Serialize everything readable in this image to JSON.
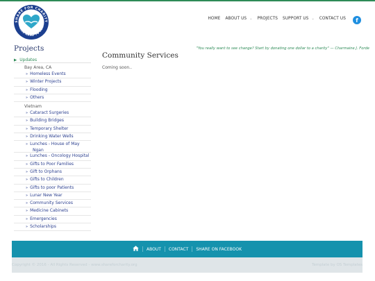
{
  "logo": {
    "top_text": "SHARE FOR CHARITY",
    "bottom_text": "SHARE HAND TO HELP"
  },
  "nav": {
    "items": [
      {
        "label": "HOME",
        "dropdown": false
      },
      {
        "label": "ABOUT US",
        "dropdown": true
      },
      {
        "label": "PROJECTS",
        "dropdown": false
      },
      {
        "label": "SUPPORT US",
        "dropdown": true
      },
      {
        "label": "CONTACT US",
        "dropdown": false
      }
    ],
    "facebook_glyph": "f"
  },
  "sidebar": {
    "title": "Projects",
    "updates_label": "Updates",
    "groups": [
      {
        "label": "Bay Area, CA",
        "items": [
          "Homeless Events",
          "Winter Projects",
          "Flooding",
          "Others"
        ]
      },
      {
        "label": "Vietnam",
        "items": [
          "Cataract Surgeries",
          "Building Bridges",
          "Temporary Shelter",
          "Drinking Water Wells",
          "Lunches - House of May Ngan",
          "Lunches - Oncology Hospital",
          "Gifts to Poor Families",
          "Gift to Orphans",
          "Gifts to Children",
          "Gifts to poor Patients",
          "Lunar New Year",
          "Community Services",
          "Medicine Cabinets",
          "Emergencies",
          "Scholarships"
        ]
      }
    ]
  },
  "main": {
    "quote": "\"You really want to see change? Start by donating one dollar to a charity\" — Charmaine J. Forde",
    "title": "Community Services",
    "body": "Coming soon.."
  },
  "footer": {
    "links": [
      "ABOUT",
      "CONTACT",
      "SHARE ON FACEBOOK"
    ],
    "copyright": "Copyright © 2016 - All Rights Reserved - www.shareforcharity.org",
    "credit": "Template by OS Templates"
  },
  "colors": {
    "accent_green": "#2e8b57",
    "link_blue": "#2b3f8f",
    "footer_teal": "#1592ad",
    "facebook_blue": "#1f8fe0"
  }
}
